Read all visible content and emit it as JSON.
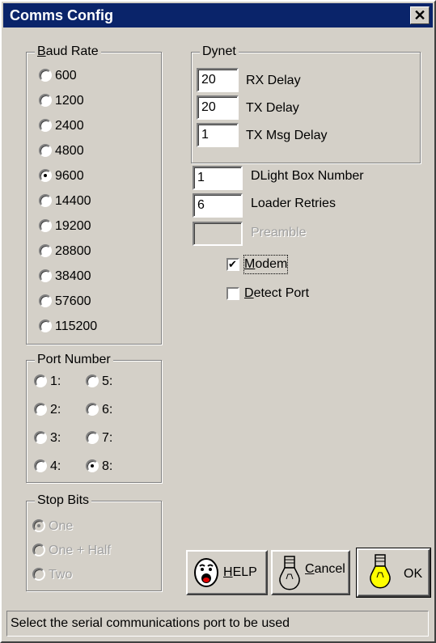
{
  "window": {
    "title": "Comms Config",
    "close_glyph": "✕"
  },
  "baud_rate": {
    "legend": "Baud Rate",
    "options": [
      "600",
      "1200",
      "2400",
      "4800",
      "9600",
      "14400",
      "19200",
      "28800",
      "38400",
      "57600",
      "115200"
    ],
    "selected": "9600"
  },
  "port_number": {
    "legend": "Port Number",
    "options": [
      "1:",
      "2:",
      "3:",
      "4:",
      "5:",
      "6:",
      "7:",
      "8:"
    ],
    "selected": "8:"
  },
  "stop_bits": {
    "legend": "Stop Bits",
    "options": [
      "One",
      "One + Half",
      "Two"
    ],
    "selected": "One",
    "enabled": false
  },
  "dynet": {
    "legend": "Dynet",
    "rx_delay": {
      "value": "20",
      "label": "RX Delay"
    },
    "tx_delay": {
      "value": "20",
      "label": "TX Delay"
    },
    "tx_msg_delay": {
      "value": "1",
      "label": "TX Msg Delay"
    }
  },
  "dlight_box": {
    "value": "1",
    "label": "DLight Box Number"
  },
  "loader_retries": {
    "value": "6",
    "label": "Loader Retries"
  },
  "preamble": {
    "value": "",
    "label": "Preamble",
    "enabled": false
  },
  "modem": {
    "label": "Modem",
    "checked": true
  },
  "detect_port": {
    "label": "Detect Port",
    "checked": false
  },
  "buttons": {
    "help": {
      "label": "HELP",
      "icon": "face-icon"
    },
    "cancel": {
      "label": "Cancel",
      "icon": "unlit-bulb-icon"
    },
    "ok": {
      "label": "OK",
      "icon": "lit-bulb-icon"
    }
  },
  "status": {
    "text": "Select the serial communications port to be used"
  },
  "colors": {
    "title_bar": "#0a246a",
    "face": "#d4d0c8",
    "bulb_lit": "#ffff00"
  }
}
